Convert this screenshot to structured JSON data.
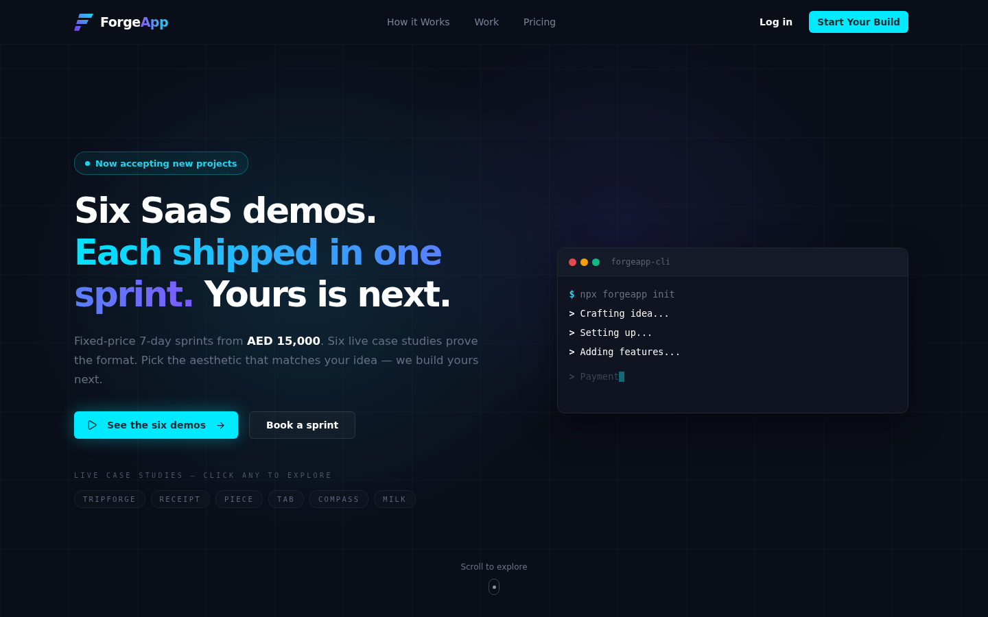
{
  "brand": {
    "first": "Forge",
    "second": "App"
  },
  "nav": {
    "links": [
      "How it Works",
      "Work",
      "Pricing"
    ],
    "login": "Log in",
    "cta": "Start Your Build"
  },
  "hero": {
    "badge": "Now accepting new projects",
    "headline": [
      {
        "kind": "plain",
        "text": "Six SaaS demos."
      },
      {
        "kind": "accent",
        "text": "Each shipped in one sprint."
      },
      {
        "kind": "plain",
        "text": "Yours is next."
      }
    ],
    "description": "Fixed-price 7-day sprints from **AED 15,000**. Six live case studies prove the format. Pick the aesthetic that matches your idea — we build yours next.",
    "primary_button": "See the six demos",
    "secondary_button": "Book a sprint",
    "case_studies_label": "LIVE CASE STUDIES — CLICK ANY TO EXPLORE",
    "case_studies": [
      "TRIPFORGE",
      "RECEIPT",
      "PIECE",
      "TAB",
      "COMPASS",
      "MILK"
    ]
  },
  "terminal": {
    "title": "forgeapp-cli",
    "lines": [
      {
        "kind": "command",
        "prompt": "$",
        "text": "npx forgeapp init"
      },
      {
        "kind": "output",
        "prompt": ">",
        "text": "Crafting idea..."
      },
      {
        "kind": "output",
        "prompt": ">",
        "text": "Setting up..."
      },
      {
        "kind": "output",
        "prompt": ">",
        "text": "Adding features..."
      },
      {
        "kind": "pending",
        "prompt": ">",
        "text": "Payment"
      }
    ]
  },
  "scroll_hint": "Scroll to explore"
}
